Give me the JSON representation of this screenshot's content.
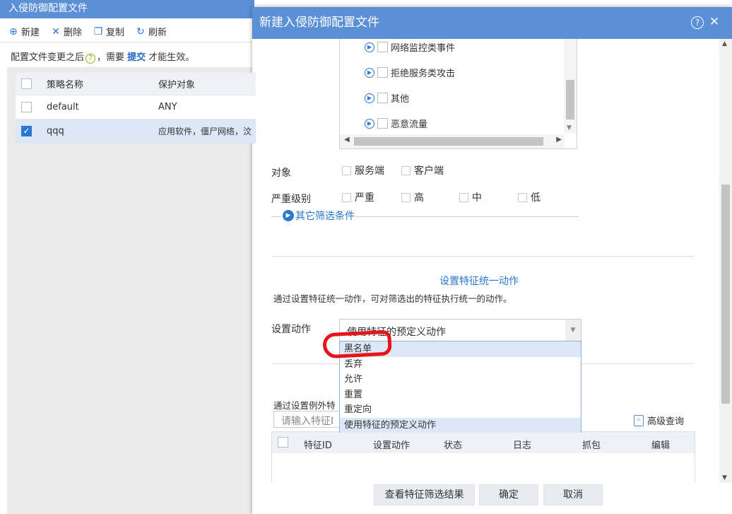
{
  "background": {
    "title": "入侵防御配置文件",
    "toolbar": [
      {
        "icon": "plus-circle-icon",
        "label": "新建"
      },
      {
        "icon": "x-icon",
        "label": "删除"
      },
      {
        "icon": "copy-icon",
        "label": "复制"
      },
      {
        "icon": "refresh-icon",
        "label": "刷新"
      }
    ],
    "notice": {
      "before": "配置文件变更之后",
      "middle": "，需要 ",
      "link": "提交",
      "after": " 才能生效。"
    },
    "table": {
      "headers": [
        "策略名称",
        "保护对象"
      ],
      "rows": [
        {
          "name": "default",
          "object": "ANY",
          "checked": false
        },
        {
          "name": "qqq",
          "object": "应用软件，僵尸网络，汶",
          "checked": true
        }
      ]
    }
  },
  "dialog": {
    "title": "新建入侵防御配置文件",
    "events": [
      "网络监控类事件",
      "拒绝服务类攻击",
      "其他",
      "恶意流量"
    ],
    "target": {
      "label": "对象",
      "options": [
        "服务端",
        "客户端"
      ]
    },
    "severity": {
      "label": "严重级别",
      "options": [
        "严重",
        "高",
        "中",
        "低"
      ]
    },
    "other_filters": "其它筛选条件",
    "section_title": "设置特征统一动作",
    "section_desc": "通过设置特征统一动作，可对筛选出的特征执行统一的动作。",
    "action": {
      "label": "设置动作",
      "value": "使用特征的预定义动作",
      "options": [
        "黑名单",
        "丢弃",
        "允许",
        "重置",
        "重定向",
        "使用特征的预定义动作"
      ]
    },
    "exception_desc": "通过设置例外特",
    "search_placeholder": "请输入特征I",
    "advanced_query": "高级查询",
    "exception_table_headers": [
      "特征ID",
      "设置动作",
      "状态",
      "日志",
      "抓包",
      "编辑"
    ],
    "buttons": {
      "view": "查看特征筛选结果",
      "ok": "确定",
      "cancel": "取消"
    }
  },
  "colors": {
    "accent": "#5b8fd6",
    "link": "#2b77d1",
    "annotation": "#e8141b"
  }
}
